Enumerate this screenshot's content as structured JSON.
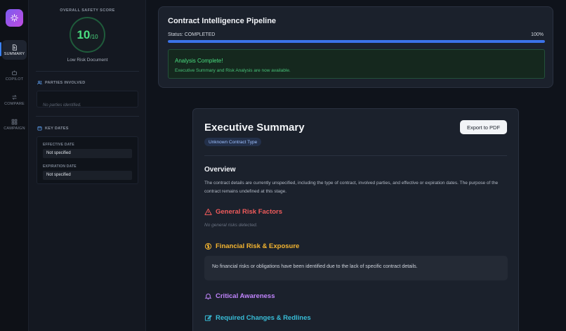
{
  "colors": {
    "accent": "#3b82f6",
    "success": "#4ade80",
    "danger": "#ef5b5b",
    "warning": "#f5b530",
    "purple": "#c084fc",
    "cyan": "#38bdd8"
  },
  "rail": {
    "items": [
      {
        "label": "SUMMARY",
        "icon": "document-icon",
        "active": true
      },
      {
        "label": "COPILOT",
        "icon": "robot-icon",
        "active": false
      },
      {
        "label": "COMPARE",
        "icon": "arrows-swap-icon",
        "active": false
      },
      {
        "label": "CAMPAIGN",
        "icon": "grid-icon",
        "active": false
      }
    ]
  },
  "panel": {
    "score_title": "OVERALL SAFETY SCORE",
    "score": "10",
    "score_max": "/10",
    "score_label": "Low Risk Document",
    "parties": {
      "title": "PARTIES INVOLVED",
      "empty": "No parties identified."
    },
    "key_dates": {
      "title": "KEY DATES",
      "effective_label": "EFFECTIVE DATE",
      "effective_value": "Not specified",
      "expiration_label": "EXPIRATION DATE",
      "expiration_value": "Not specified"
    }
  },
  "pipeline": {
    "title": "Contract Intelligence Pipeline",
    "status": "Status: COMPLETED",
    "percent_label": "100%",
    "progress": 100,
    "notice_title": "Analysis Complete!",
    "notice_text": "Executive Summary and Risk Analysis are now available."
  },
  "summary": {
    "title": "Executive Summary",
    "export_label": "Export to PDF",
    "contract_type": "Unknown Contract Type",
    "overview_title": "Overview",
    "overview_text": "The contract details are currently unspecified, including the type of contract, involved parties, and effective or expiration dates. The purpose of the contract remains undefined at this stage.",
    "general_risks_title": "General Risk Factors",
    "general_risks_empty": "No general risks detected.",
    "financial_title": "Financial Risk & Exposure",
    "financial_text": "No financial risks or obligations have been identified due to the lack of specific contract details.",
    "critical_title": "Critical Awareness",
    "changes_title": "Required Changes & Redlines"
  }
}
